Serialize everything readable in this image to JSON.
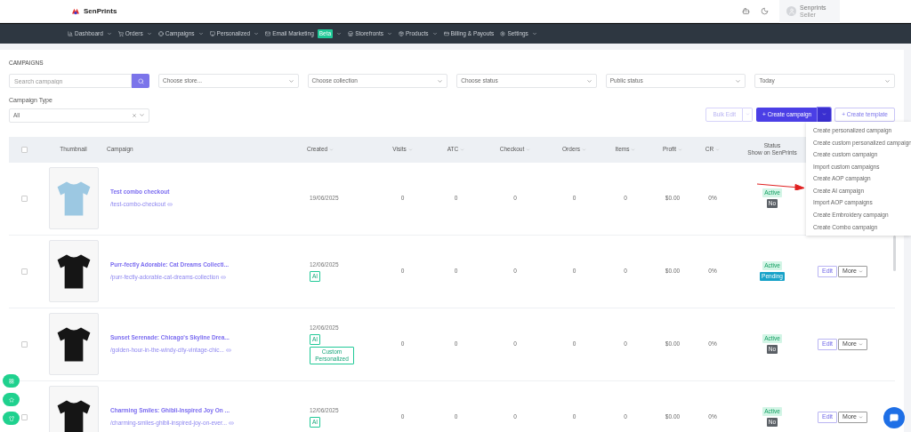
{
  "header": {
    "logo": "SenPrints",
    "user": {
      "name": "Senprints",
      "role": "Seller"
    }
  },
  "nav": [
    {
      "label": "Dashboard",
      "has_menu": true
    },
    {
      "label": "Orders",
      "has_menu": true
    },
    {
      "label": "Campaigns",
      "has_menu": true
    },
    {
      "label": "Personalized",
      "has_menu": true
    },
    {
      "label": "Email Marketing",
      "badge": "Beta",
      "has_menu": true
    },
    {
      "label": "Storefronts",
      "has_menu": true
    },
    {
      "label": "Products",
      "has_menu": true
    },
    {
      "label": "Billing & Payouts",
      "has_menu": false
    },
    {
      "label": "Settings",
      "has_menu": true
    }
  ],
  "page_title": "CAMPAIGNS",
  "search": {
    "placeholder": "Search campaign"
  },
  "filters": [
    {
      "value": "Choose store..."
    },
    {
      "value": "Choose collection"
    },
    {
      "value": "Choose status"
    },
    {
      "value": "Public status"
    },
    {
      "value": "Today"
    }
  ],
  "campaign_type": {
    "label": "Campaign Type",
    "value": "All"
  },
  "toolbar": {
    "bulk_edit": {
      "label": "Bulk Edit",
      "disabled": true
    },
    "create_campaign": {
      "label": "+ Create campaign",
      "menu_open": true
    },
    "create_template": {
      "label": "+ Create template"
    }
  },
  "create_menu": [
    "Create personalized campaign",
    "Create custom personalized campaign",
    "Create custom campaign",
    "Import custom campaigns",
    "Create AOP campaign",
    "Create AI campaign",
    "Import AOP campaigns",
    "Create Embroidery campaign",
    "Create Combo campaign"
  ],
  "table": {
    "header_checked": false,
    "columns": [
      {
        "label": "Thumbnail",
        "sortable": false
      },
      {
        "label": "Campaign",
        "sortable": false
      },
      {
        "label": "Created",
        "sortable": true
      },
      {
        "label": "Visits",
        "sortable": true
      },
      {
        "label": "ATC",
        "sortable": true
      },
      {
        "label": "Checkout",
        "sortable": true
      },
      {
        "label": "Orders",
        "sortable": true
      },
      {
        "label": "Items",
        "sortable": true
      },
      {
        "label": "Profit",
        "sortable": true
      },
      {
        "label": "CR",
        "sortable": true
      },
      {
        "label": "Status",
        "sublabel": "Show on SenPrints",
        "sortable": false
      }
    ],
    "rows": [
      {
        "checked": false,
        "color": "#9cc8e2",
        "name": "Test combo checkout",
        "slug": "/test-combo-checkout",
        "created": "19/06/2025",
        "visits": "0",
        "atc": "0",
        "checkout": "0",
        "orders": "0",
        "items": "0",
        "profit": "$0.00",
        "cr": "0%",
        "status": [
          {
            "label": "Active",
            "kind": "active"
          },
          {
            "label": "No",
            "kind": "no"
          }
        ]
      },
      {
        "checked": false,
        "color": "#151515",
        "name": "Purr-fectly Adorable: Cat Dreams Collecti...",
        "slug": "/purr-fectly-adorable-cat-dreams-collection",
        "created": "12/06/2025",
        "tags": [
          "AI"
        ],
        "visits": "0",
        "atc": "0",
        "checkout": "0",
        "orders": "0",
        "items": "0",
        "profit": "$0.00",
        "cr": "0%",
        "status": [
          {
            "label": "Active",
            "kind": "active"
          },
          {
            "label": "Pending",
            "kind": "pending"
          }
        ],
        "actions": {
          "edit": "Edit",
          "more": "More"
        }
      },
      {
        "checked": false,
        "color": "#151515",
        "name": "Sunset Serenade: Chicago's Skyline Drea...",
        "slug": "/golden-hour-in-the-windy-city-vintage-chic...",
        "created": "12/06/2025",
        "tags": [
          "AI",
          "Custom Personalized"
        ],
        "visits": "0",
        "atc": "0",
        "checkout": "0",
        "orders": "0",
        "items": "0",
        "profit": "$0.00",
        "cr": "0%",
        "status": [
          {
            "label": "Active",
            "kind": "active"
          },
          {
            "label": "No",
            "kind": "no"
          }
        ],
        "actions": {
          "edit": "Edit",
          "more": "More"
        }
      },
      {
        "checked": false,
        "color": "#151515",
        "name": "Charming Smiles: Ghibli-Inspired Joy On ...",
        "slug": "/charming-smiles-ghibli-inspired-joy-on-ever...",
        "created": "12/06/2025",
        "tags": [
          "AI"
        ],
        "visits": "0",
        "atc": "0",
        "checkout": "0",
        "orders": "0",
        "items": "0",
        "profit": "$0.00",
        "cr": "0%",
        "status": [
          {
            "label": "Active",
            "kind": "active"
          },
          {
            "label": "No",
            "kind": "no"
          }
        ],
        "actions": {
          "edit": "Edit",
          "more": "More"
        }
      }
    ]
  }
}
